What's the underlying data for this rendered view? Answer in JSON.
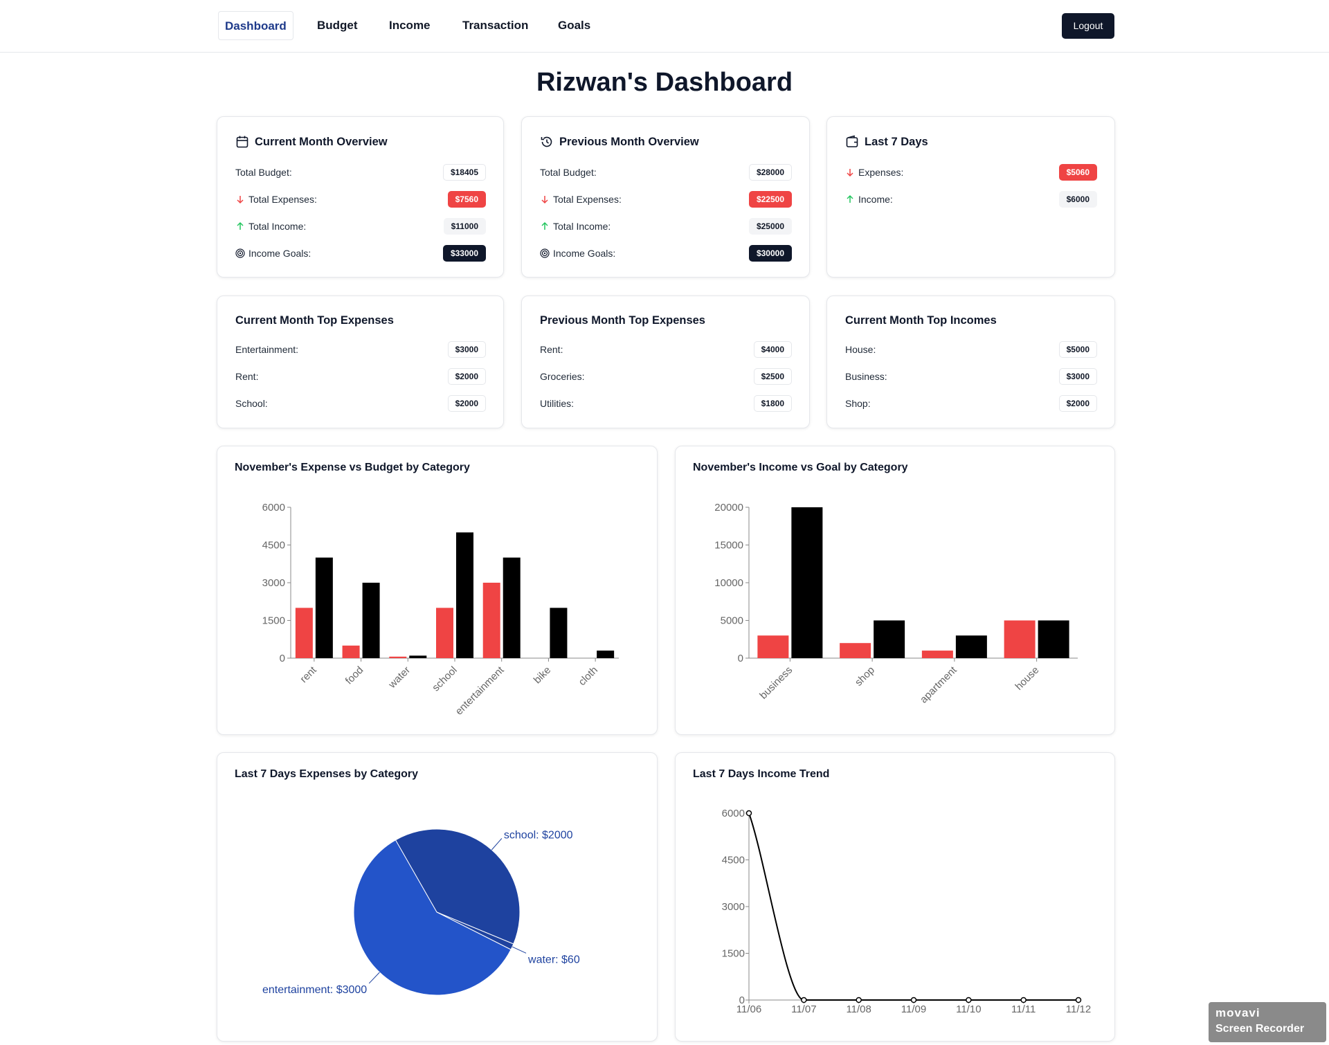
{
  "nav": {
    "items": [
      "Dashboard",
      "Budget",
      "Income",
      "Transaction",
      "Goals"
    ],
    "active": "Dashboard",
    "logout_label": "Logout"
  },
  "page_title": "Rizwan's Dashboard",
  "colors": {
    "expense": "#ef4444",
    "budget": "#000000",
    "dark": "#0f172a",
    "up": "#22c55e",
    "pie_dark": "#1e429f",
    "pie_light": "#2354c9"
  },
  "overview": {
    "current": {
      "title": "Current Month Overview",
      "icon": "calendar-icon",
      "rows": [
        {
          "label": "Total Budget:",
          "value": "$18405"
        },
        {
          "label": "Total Expenses:",
          "value": "$7560"
        },
        {
          "label": "Total Income:",
          "value": "$11000"
        },
        {
          "label": "Income Goals:",
          "value": "$33000"
        }
      ]
    },
    "previous": {
      "title": "Previous Month Overview",
      "icon": "history-icon",
      "rows": [
        {
          "label": "Total Budget:",
          "value": "$28000"
        },
        {
          "label": "Total Expenses:",
          "value": "$22500"
        },
        {
          "label": "Total Income:",
          "value": "$25000"
        },
        {
          "label": "Income Goals:",
          "value": "$30000"
        }
      ]
    },
    "last7": {
      "title": "Last 7 Days",
      "icon": "wallet-icon",
      "rows": [
        {
          "label": "Expenses:",
          "value": "$5060"
        },
        {
          "label": "Income:",
          "value": "$6000"
        }
      ]
    }
  },
  "top": {
    "current_expenses": {
      "title": "Current Month Top Expenses",
      "rows": [
        {
          "label": "Entertainment:",
          "value": "$3000"
        },
        {
          "label": "Rent:",
          "value": "$2000"
        },
        {
          "label": "School:",
          "value": "$2000"
        }
      ]
    },
    "previous_expenses": {
      "title": "Previous Month Top Expenses",
      "rows": [
        {
          "label": "Rent:",
          "value": "$4000"
        },
        {
          "label": "Groceries:",
          "value": "$2500"
        },
        {
          "label": "Utilities:",
          "value": "$1800"
        }
      ]
    },
    "current_incomes": {
      "title": "Current Month Top Incomes",
      "rows": [
        {
          "label": "House:",
          "value": "$5000"
        },
        {
          "label": "Business:",
          "value": "$3000"
        },
        {
          "label": "Shop:",
          "value": "$2000"
        }
      ]
    }
  },
  "chart_data": [
    {
      "type": "bar",
      "title": "November's Expense vs Budget by Category",
      "categories": [
        "rent",
        "food",
        "water",
        "school",
        "entertainment",
        "bike",
        "cloth"
      ],
      "series": [
        {
          "values": [
            2000,
            500,
            60,
            2000,
            3000,
            0,
            0
          ],
          "color": "#ef4444"
        },
        {
          "values": [
            4000,
            3000,
            100,
            5000,
            4000,
            2000,
            300
          ],
          "color": "#000000"
        }
      ],
      "yticks": [
        0,
        1500,
        3000,
        4500,
        6000
      ],
      "ylim": [
        0,
        6000
      ],
      "xlabel": "",
      "ylabel": "",
      "grid": false
    },
    {
      "type": "bar",
      "title": "November's Income vs Goal by Category",
      "categories": [
        "business",
        "shop",
        "apartment",
        "house"
      ],
      "series": [
        {
          "values": [
            3000,
            2000,
            1000,
            5000
          ],
          "color": "#ef4444"
        },
        {
          "values": [
            20000,
            5000,
            3000,
            5000
          ],
          "color": "#000000"
        }
      ],
      "yticks": [
        0,
        5000,
        10000,
        15000,
        20000
      ],
      "ylim": [
        0,
        20000
      ],
      "xlabel": "",
      "ylabel": "",
      "grid": false
    },
    {
      "type": "pie",
      "title": "Last 7 Days Expenses by Category",
      "slices": [
        {
          "label": "school",
          "value": 2000,
          "text": "school: $2000"
        },
        {
          "label": "water",
          "value": 60,
          "text": "water: $60"
        },
        {
          "label": "entertainment",
          "value": 3000,
          "text": "entertainment: $3000"
        }
      ]
    },
    {
      "type": "line",
      "title": "Last 7 Days Income Trend",
      "x": [
        "11/06",
        "11/07",
        "11/08",
        "11/09",
        "11/10",
        "11/11",
        "11/12"
      ],
      "y": [
        6000,
        0,
        0,
        0,
        0,
        0,
        0
      ],
      "yticks": [
        0,
        1500,
        3000,
        4500,
        6000
      ],
      "ylim": [
        0,
        6000
      ],
      "xlabel": "",
      "ylabel": "",
      "grid": false
    }
  ],
  "watermark": {
    "brand": "movavi",
    "sub": "Screen Recorder"
  }
}
